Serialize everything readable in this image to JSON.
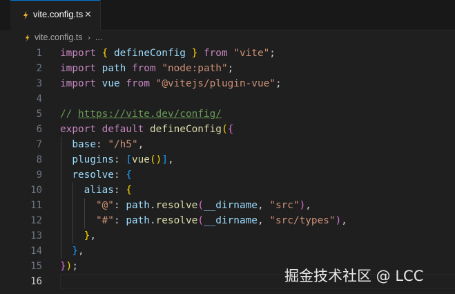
{
  "tab": {
    "filename": "vite.config.ts",
    "close_glyph": "✕",
    "icon": "typescript-file-icon"
  },
  "breadcrumb": {
    "file": "vite.config.ts",
    "separator": "›",
    "more": "..."
  },
  "editor": {
    "language": "typescript",
    "active_line": 16,
    "lines": [
      {
        "n": "1",
        "tokens": [
          [
            "kw",
            "import"
          ],
          [
            "pu",
            " "
          ],
          [
            "b1",
            "{"
          ],
          [
            "pu",
            " "
          ],
          [
            "var",
            "defineConfig"
          ],
          [
            "pu",
            " "
          ],
          [
            "b1",
            "}"
          ],
          [
            "pu",
            " "
          ],
          [
            "kw",
            "from"
          ],
          [
            "pu",
            " "
          ],
          [
            "st",
            "\"vite\""
          ],
          [
            "pu",
            ";"
          ]
        ]
      },
      {
        "n": "2",
        "tokens": [
          [
            "kw",
            "import"
          ],
          [
            "pu",
            " "
          ],
          [
            "var",
            "path"
          ],
          [
            "pu",
            " "
          ],
          [
            "kw",
            "from"
          ],
          [
            "pu",
            " "
          ],
          [
            "st",
            "\"node:path\""
          ],
          [
            "pu",
            ";"
          ]
        ]
      },
      {
        "n": "3",
        "tokens": [
          [
            "kw",
            "import"
          ],
          [
            "pu",
            " "
          ],
          [
            "var",
            "vue"
          ],
          [
            "pu",
            " "
          ],
          [
            "kw",
            "from"
          ],
          [
            "pu",
            " "
          ],
          [
            "st",
            "\"@vitejs/plugin-vue\""
          ],
          [
            "pu",
            ";"
          ]
        ]
      },
      {
        "n": "4",
        "tokens": []
      },
      {
        "n": "5",
        "tokens": [
          [
            "cm",
            "// "
          ],
          [
            "link",
            "https://vite.dev/config/"
          ]
        ]
      },
      {
        "n": "6",
        "tokens": [
          [
            "kw",
            "export"
          ],
          [
            "pu",
            " "
          ],
          [
            "kw",
            "default"
          ],
          [
            "pu",
            " "
          ],
          [
            "fn",
            "defineConfig"
          ],
          [
            "b1",
            "("
          ],
          [
            "b2",
            "{"
          ]
        ]
      },
      {
        "n": "7",
        "tokens": [
          [
            "pu",
            "  "
          ],
          [
            "var",
            "base"
          ],
          [
            "pu",
            ": "
          ],
          [
            "st",
            "\"/h5\""
          ],
          [
            "pu",
            ","
          ]
        ]
      },
      {
        "n": "8",
        "tokens": [
          [
            "pu",
            "  "
          ],
          [
            "var",
            "plugins"
          ],
          [
            "pu",
            ": "
          ],
          [
            "b3",
            "["
          ],
          [
            "fn",
            "vue"
          ],
          [
            "b1",
            "()"
          ],
          [
            "b3",
            "]"
          ],
          [
            "pu",
            ","
          ]
        ]
      },
      {
        "n": "9",
        "tokens": [
          [
            "pu",
            "  "
          ],
          [
            "var",
            "resolve"
          ],
          [
            "pu",
            ": "
          ],
          [
            "b3",
            "{"
          ]
        ]
      },
      {
        "n": "10",
        "tokens": [
          [
            "pu",
            "    "
          ],
          [
            "var",
            "alias"
          ],
          [
            "pu",
            ": "
          ],
          [
            "b1",
            "{"
          ]
        ]
      },
      {
        "n": "11",
        "tokens": [
          [
            "pu",
            "      "
          ],
          [
            "st",
            "\"@\""
          ],
          [
            "pu",
            ": "
          ],
          [
            "var",
            "path"
          ],
          [
            "pu",
            "."
          ],
          [
            "fn",
            "resolve"
          ],
          [
            "b2",
            "("
          ],
          [
            "var",
            "__dirname"
          ],
          [
            "pu",
            ", "
          ],
          [
            "st",
            "\"src\""
          ],
          [
            "b2",
            ")"
          ],
          [
            "pu",
            ","
          ]
        ]
      },
      {
        "n": "12",
        "tokens": [
          [
            "pu",
            "      "
          ],
          [
            "st",
            "\"#\""
          ],
          [
            "pu",
            ": "
          ],
          [
            "var",
            "path"
          ],
          [
            "pu",
            "."
          ],
          [
            "fn",
            "resolve"
          ],
          [
            "b2",
            "("
          ],
          [
            "var",
            "__dirname"
          ],
          [
            "pu",
            ", "
          ],
          [
            "st",
            "\"src/types\""
          ],
          [
            "b2",
            ")"
          ],
          [
            "pu",
            ","
          ]
        ]
      },
      {
        "n": "13",
        "tokens": [
          [
            "pu",
            "    "
          ],
          [
            "b1",
            "}"
          ],
          [
            "pu",
            ","
          ]
        ]
      },
      {
        "n": "14",
        "tokens": [
          [
            "pu",
            "  "
          ],
          [
            "b3",
            "}"
          ],
          [
            "pu",
            ","
          ]
        ]
      },
      {
        "n": "15",
        "tokens": [
          [
            "b2",
            "}"
          ],
          [
            "b1",
            ")"
          ],
          [
            "pu",
            ";"
          ]
        ]
      },
      {
        "n": "16",
        "tokens": []
      }
    ]
  },
  "watermark": "掘金技术社区 @ LCC",
  "colors": {
    "accent": "#0078d4",
    "ts_icon": "#e8b32c",
    "background": "#1f1f1f"
  }
}
